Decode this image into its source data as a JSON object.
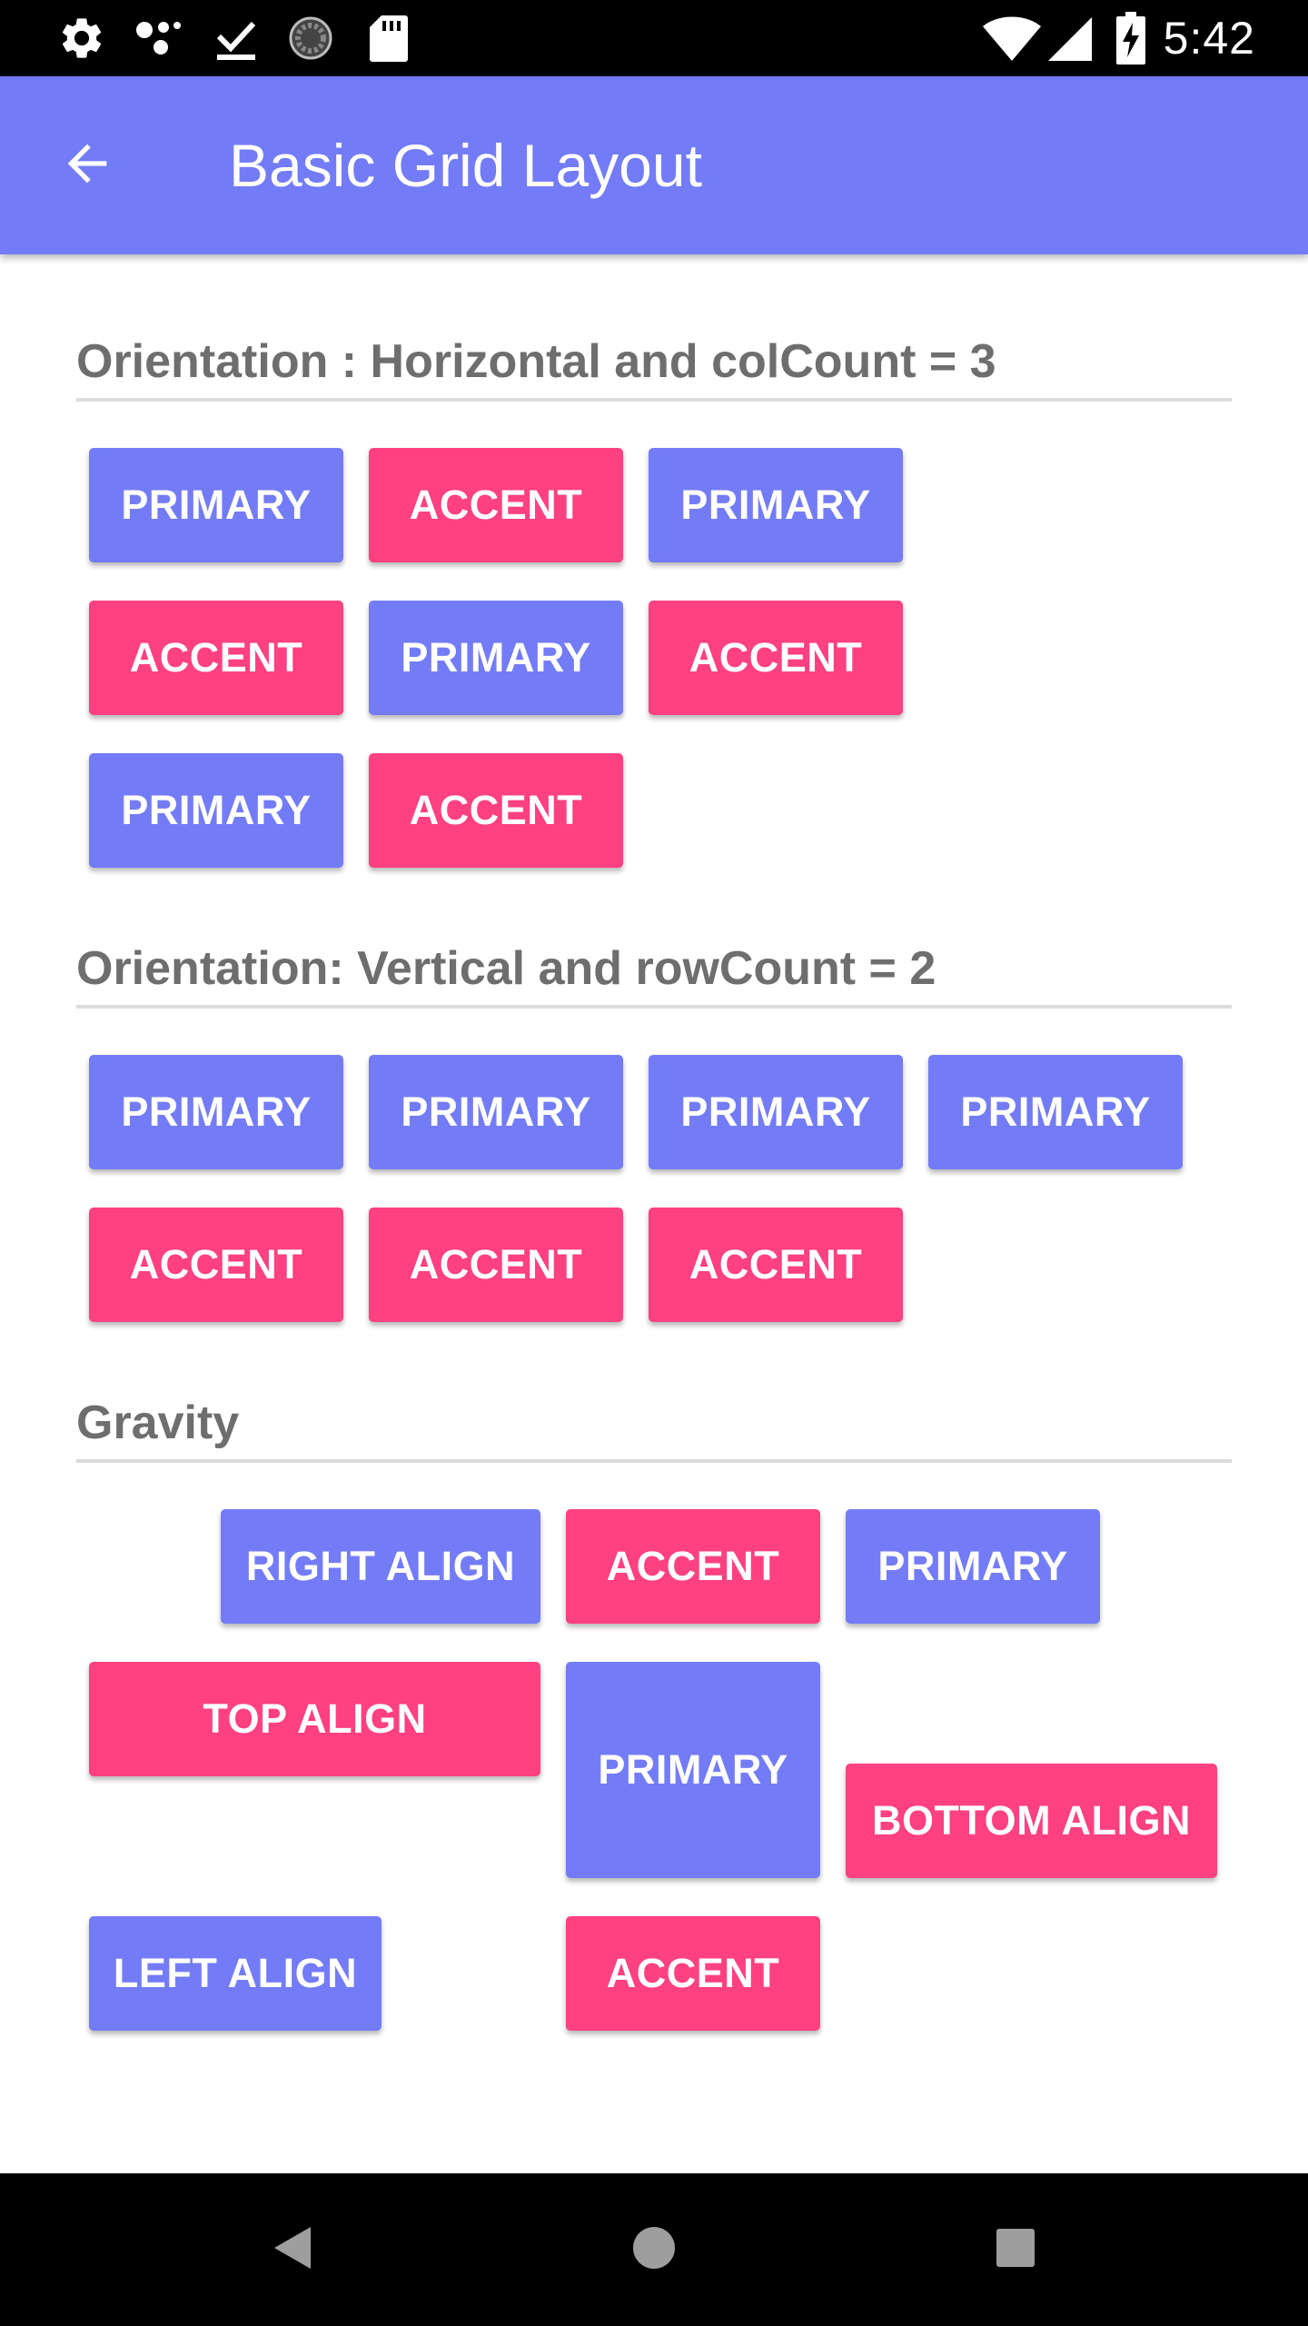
{
  "status_bar": {
    "time": "5:42",
    "left_icons": [
      "settings-icon",
      "assistant-icon",
      "download-done-icon",
      "sync-icon",
      "sd-card-icon"
    ],
    "right_icons": [
      "wifi-icon",
      "cell-signal-icon",
      "battery-charging-icon"
    ]
  },
  "app_bar": {
    "title": "Basic Grid Layout",
    "back_icon": "arrow-back-icon",
    "color": "#737cf6"
  },
  "colors": {
    "primary": "#737cf6",
    "accent": "#ff4081",
    "section_title": "#6e6e6e",
    "divider": "#dcdcdc"
  },
  "sections": {
    "horizontal": {
      "title": "Orientation : Horizontal and colCount = 3",
      "buttons": [
        "PRIMARY",
        "ACCENT",
        "PRIMARY",
        "ACCENT",
        "PRIMARY",
        "ACCENT",
        "PRIMARY",
        "ACCENT"
      ]
    },
    "vertical": {
      "title": "Orientation: Vertical and rowCount = 2",
      "buttons": [
        "PRIMARY",
        "PRIMARY",
        "PRIMARY",
        "PRIMARY",
        "ACCENT",
        "ACCENT",
        "ACCENT"
      ]
    },
    "gravity": {
      "title": "Gravity",
      "buttons": {
        "right_align": "RIGHT ALIGN",
        "accent_1": "ACCENT",
        "primary_1": "PRIMARY",
        "top_align": "TOP ALIGN",
        "primary_2": "PRIMARY",
        "bottom_align": "BOTTOM ALIGN",
        "left_align": "LEFT ALIGN",
        "accent_2": "ACCENT"
      }
    }
  },
  "nav_bar": {
    "icons": [
      "back-triangle-icon",
      "home-circle-icon",
      "recents-square-icon"
    ]
  }
}
